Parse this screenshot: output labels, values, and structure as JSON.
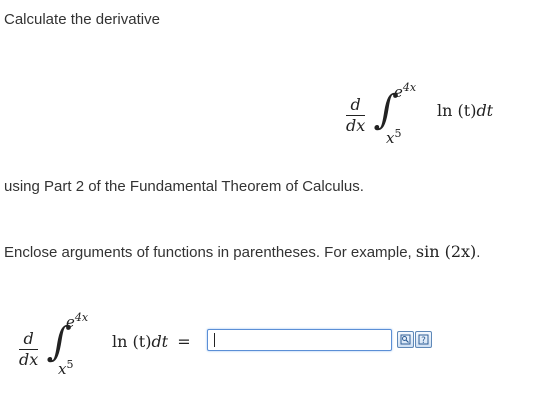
{
  "instructions": {
    "line1": "Calculate the derivative",
    "line2": "using Part 2 of the Fundamental Theorem of Calculus.",
    "line3_prefix": "Enclose arguments of functions in parentheses. For example, ",
    "line3_example": "sin (2x)",
    "line3_suffix": "."
  },
  "expression": {
    "d_num": "d",
    "d_den": "dx",
    "integral_sign": "∫",
    "upper_base": "e",
    "upper_exp": "4x",
    "lower_base": "x",
    "lower_exp": "5",
    "integrand_fn": "ln",
    "integrand_arg": "(t)",
    "differential": "dt",
    "equals": "="
  },
  "answer": {
    "value": ""
  },
  "toolbar": {
    "preview_icon": "preview-icon",
    "help_icon": "equation-help-icon"
  }
}
